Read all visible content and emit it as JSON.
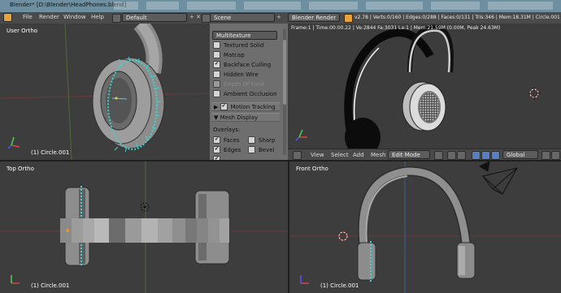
{
  "window": {
    "title": "Blender* [D:\\Blender\\HeadPhones.blend]"
  },
  "menu": {
    "file": "File",
    "render": "Render",
    "window": "Window",
    "help": "Help",
    "layout": "Default",
    "scene": "Scene",
    "engine": "Blender Render",
    "stats": "v2.78 | Verts:0/160 | Edges:0/288 | Faces:0/131 | Tris:346 | Mem:18.31M | Circle.001"
  },
  "viewports": {
    "user": {
      "label": "User Ortho",
      "object": "(1) Circle.001"
    },
    "top": {
      "label": "Top Ortho",
      "object": "(1) Circle.001"
    },
    "front": {
      "label": "Front Ortho",
      "object": "(1) Circle.001"
    }
  },
  "properties": {
    "shading": "Multitexture",
    "textured_solid": "Textured Solid",
    "matcap": "Matcap",
    "backface_culling": "Backface Culling",
    "hidden_wire": "Hidden Wire",
    "depth_of_field": "Depth Of Field",
    "ambient_occlusion": "Ambient Occlusion",
    "motion_tracking": "Motion Tracking",
    "mesh_display": "Mesh Display",
    "overlays": "Overlays:",
    "faces": "Faces",
    "sharp": "Sharp",
    "edges": "Edges",
    "bevel": "Bevel"
  },
  "render_view": {
    "info": "Frame:1 | Time:00:00.22 | Ve:2844 Fa:3031 La:1 | Mem:21.59M (0.00M, Peak 24.63M)"
  },
  "view_header": {
    "view": "View",
    "select": "Select",
    "add": "Add",
    "mesh": "Mesh",
    "mode": "Edit Mode",
    "orientation": "Global"
  }
}
